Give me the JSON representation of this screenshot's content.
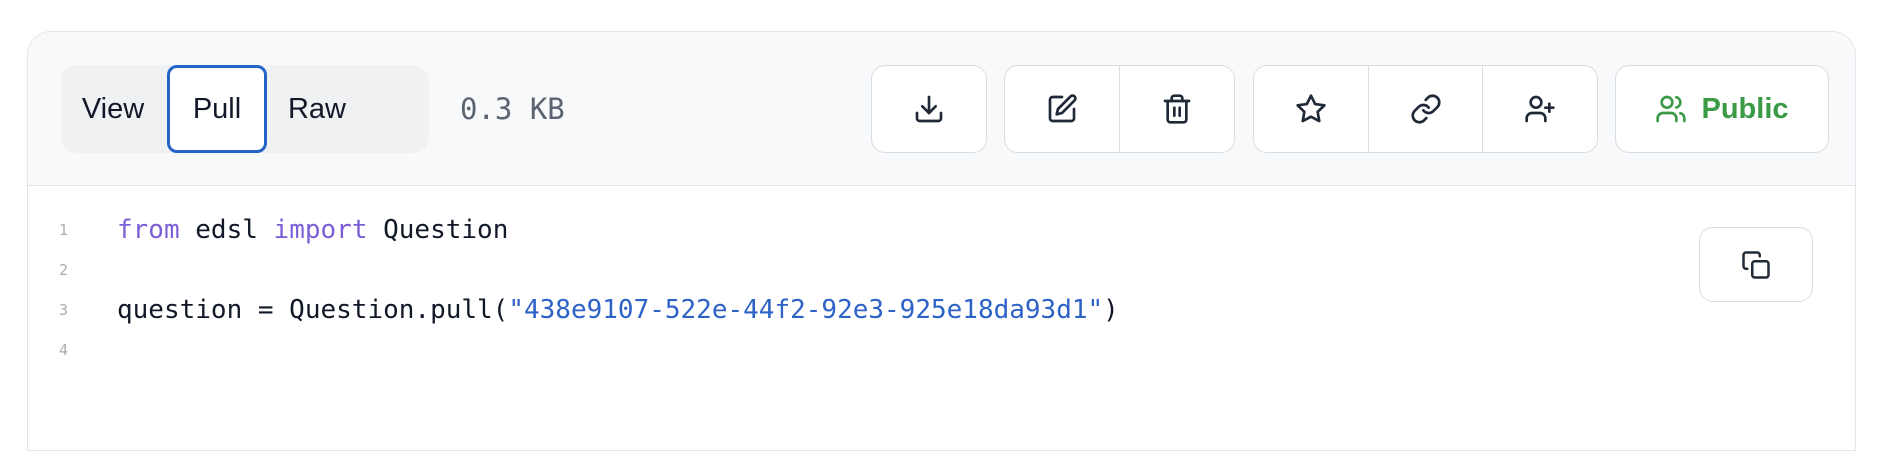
{
  "view_tabs": [
    {
      "label": "View",
      "active": false
    },
    {
      "label": "Pull",
      "active": true
    },
    {
      "label": "Raw",
      "active": false
    }
  ],
  "file_size": "0.3 KB",
  "actions": {
    "download_icon": "download-icon",
    "edit_icon": "edit-icon",
    "delete_icon": "trash-icon",
    "star_icon": "star-icon",
    "link_icon": "link-icon",
    "share_icon": "user-plus-icon",
    "visibility": {
      "label": "Public",
      "icon": "users-icon",
      "color": "#3a9a46"
    }
  },
  "code": {
    "lines": [
      {
        "number": "1",
        "tokens": [
          {
            "text": "from",
            "type": "keyword"
          },
          {
            "text": " edsl ",
            "type": "plain"
          },
          {
            "text": "import",
            "type": "keyword"
          },
          {
            "text": " Question",
            "type": "plain"
          }
        ]
      },
      {
        "number": "2",
        "tokens": []
      },
      {
        "number": "3",
        "tokens": [
          {
            "text": "question = Question.pull(",
            "type": "plain"
          },
          {
            "text": "\"438e9107-522e-44f2-92e3-925e18da93d1\"",
            "type": "string"
          },
          {
            "text": ")",
            "type": "plain"
          }
        ]
      },
      {
        "number": "4",
        "tokens": []
      }
    ],
    "copy_icon": "copy-icon"
  },
  "colors": {
    "keyword": "#7c5ed6",
    "string": "#2d63c7",
    "active_tab_border": "#2563c9"
  }
}
